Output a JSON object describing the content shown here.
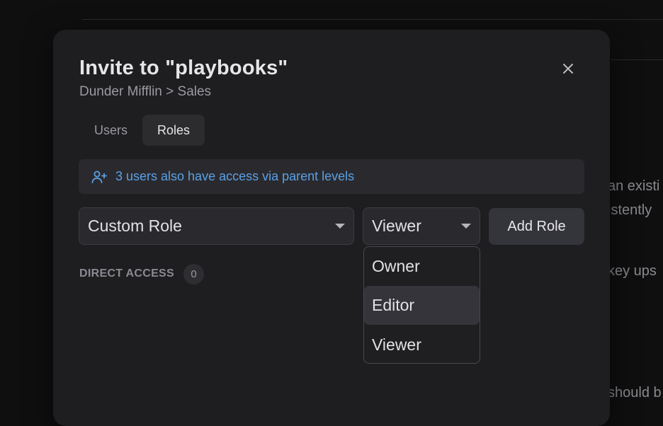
{
  "background": {
    "peek_lines": [
      "an existi",
      "istently",
      "key ups",
      "should b"
    ]
  },
  "modal": {
    "title": "Invite to \"playbooks\"",
    "breadcrumb": "Dunder Mifflin > Sales",
    "close_icon": "close-icon"
  },
  "tabs": [
    {
      "label": "Users",
      "active": false
    },
    {
      "label": "Roles",
      "active": true
    }
  ],
  "info": {
    "icon": "user-plus-icon",
    "text": "3 users also have access via parent levels"
  },
  "form": {
    "role_value": "Custom Role",
    "permission_value": "Viewer",
    "add_label": "Add Role"
  },
  "direct_access": {
    "label": "DIRECT ACCESS",
    "count": "0"
  },
  "dropdown": {
    "options": [
      "Owner",
      "Editor",
      "Viewer"
    ],
    "highlighted": "Editor"
  },
  "colors": {
    "accent_link": "#5aa0e6",
    "modal_bg": "#1e1e20",
    "page_bg": "#0f0f10"
  }
}
